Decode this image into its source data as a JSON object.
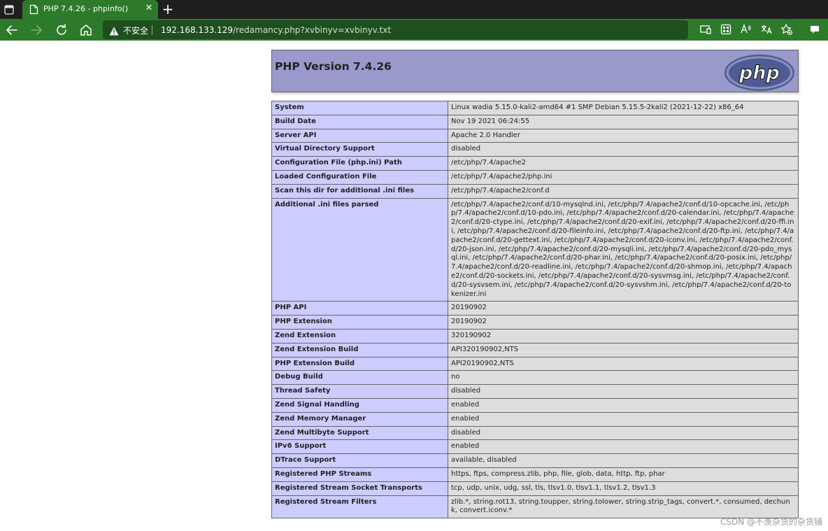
{
  "browser": {
    "tab": {
      "title": "PHP 7.4.26 - phpinfo()"
    },
    "address": {
      "security_label": "不安全",
      "url_host": "192.168.133.129",
      "url_path": "/redamancy.php?xvbinyv=xvbinyv.txt"
    },
    "icons": [
      "tab-actions-icon",
      "page-icon",
      "close-icon",
      "plus-icon",
      "back-arrow-icon",
      "forward-arrow-icon",
      "refresh-icon",
      "home-icon",
      "warning-icon",
      "device-icon",
      "apps-icon",
      "read-aloud-icon",
      "translate-icon",
      "favorite-star-icon",
      "collections-icon"
    ],
    "accent_color": "#2d7a2b"
  },
  "phpinfo": {
    "title": "PHP Version 7.4.26",
    "logo_text": "php",
    "colors": {
      "header": "#9999cc",
      "key_cell": "#ccccff",
      "value_cell": "#dddddd"
    },
    "rows": [
      {
        "key": "System",
        "value": "Linux wadia 5.15.0-kali2-amd64 #1 SMP Debian 5.15.5-2kali2 (2021-12-22) x86_64"
      },
      {
        "key": "Build Date",
        "value": "Nov 19 2021 06:24:55"
      },
      {
        "key": "Server API",
        "value": "Apache 2.0 Handler"
      },
      {
        "key": "Virtual Directory Support",
        "value": "disabled"
      },
      {
        "key": "Configuration File (php.ini) Path",
        "value": "/etc/php/7.4/apache2"
      },
      {
        "key": "Loaded Configuration File",
        "value": "/etc/php/7.4/apache2/php.ini"
      },
      {
        "key": "Scan this dir for additional .ini files",
        "value": "/etc/php/7.4/apache2/conf.d"
      },
      {
        "key": "Additional .ini files parsed",
        "value": "/etc/php/7.4/apache2/conf.d/10-mysqlnd.ini, /etc/php/7.4/apache2/conf.d/10-opcache.ini, /etc/php/7.4/apache2/conf.d/10-pdo.ini, /etc/php/7.4/apache2/conf.d/20-calendar.ini, /etc/php/7.4/apache2/conf.d/20-ctype.ini, /etc/php/7.4/apache2/conf.d/20-exif.ini, /etc/php/7.4/apache2/conf.d/20-ffi.ini, /etc/php/7.4/apache2/conf.d/20-fileinfo.ini, /etc/php/7.4/apache2/conf.d/20-ftp.ini, /etc/php/7.4/apache2/conf.d/20-gettext.ini, /etc/php/7.4/apache2/conf.d/20-iconv.ini, /etc/php/7.4/apache2/conf.d/20-json.ini, /etc/php/7.4/apache2/conf.d/20-mysqli.ini, /etc/php/7.4/apache2/conf.d/20-pdo_mysql.ini, /etc/php/7.4/apache2/conf.d/20-phar.ini, /etc/php/7.4/apache2/conf.d/20-posix.ini, /etc/php/7.4/apache2/conf.d/20-readline.ini, /etc/php/7.4/apache2/conf.d/20-shmop.ini, /etc/php/7.4/apache2/conf.d/20-sockets.ini, /etc/php/7.4/apache2/conf.d/20-sysvmsg.ini, /etc/php/7.4/apache2/conf.d/20-sysvsem.ini, /etc/php/7.4/apache2/conf.d/20-sysvshm.ini, /etc/php/7.4/apache2/conf.d/20-tokenizer.ini"
      },
      {
        "key": "PHP API",
        "value": "20190902"
      },
      {
        "key": "PHP Extension",
        "value": "20190902"
      },
      {
        "key": "Zend Extension",
        "value": "320190902"
      },
      {
        "key": "Zend Extension Build",
        "value": "API320190902,NTS"
      },
      {
        "key": "PHP Extension Build",
        "value": "API20190902,NTS"
      },
      {
        "key": "Debug Build",
        "value": "no"
      },
      {
        "key": "Thread Safety",
        "value": "disabled"
      },
      {
        "key": "Zend Signal Handling",
        "value": "enabled"
      },
      {
        "key": "Zend Memory Manager",
        "value": "enabled"
      },
      {
        "key": "Zend Multibyte Support",
        "value": "disabled"
      },
      {
        "key": "IPv6 Support",
        "value": "enabled"
      },
      {
        "key": "DTrace Support",
        "value": "available, disabled"
      },
      {
        "key": "Registered PHP Streams",
        "value": "https, ftps, compress.zlib, php, file, glob, data, http, ftp, phar"
      },
      {
        "key": "Registered Stream Socket Transports",
        "value": "tcp, udp, unix, udg, ssl, tls, tlsv1.0, tlsv1.1, tlsv1.2, tlsv1.3"
      },
      {
        "key": "Registered Stream Filters",
        "value": "zlib.*, string.rot13, string.toupper, string.tolower, string.strip_tags, convert.*, consumed, dechunk, convert.iconv.*"
      }
    ]
  },
  "watermark": "CSDN @不羡杂货的杂货铺"
}
